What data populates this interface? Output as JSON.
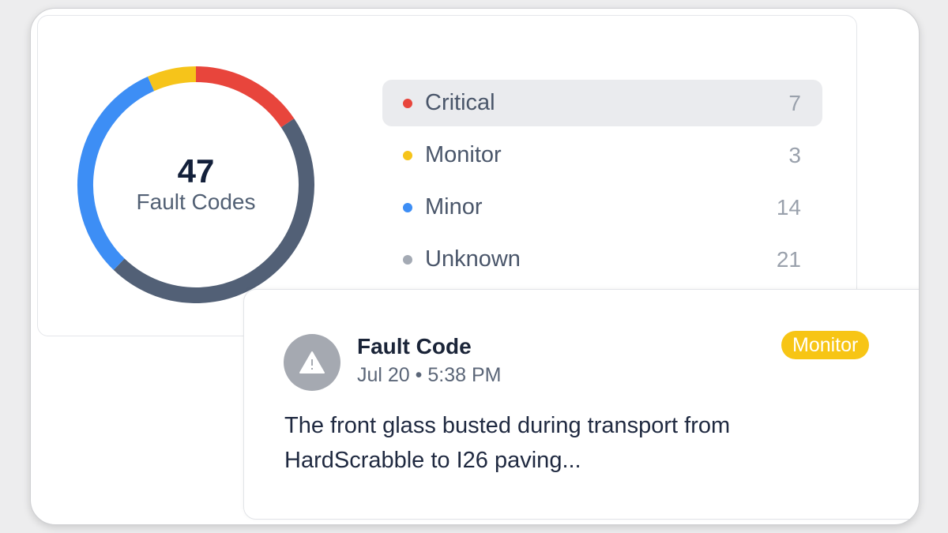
{
  "summary": {
    "total": "47",
    "total_label": "Fault Codes",
    "segments": [
      {
        "name": "Critical",
        "count": "7",
        "value": 7,
        "color": "#e8453c"
      },
      {
        "name": "Monitor",
        "count": "3",
        "value": 3,
        "color": "#f6c41a"
      },
      {
        "name": "Minor",
        "count": "14",
        "value": 14,
        "color": "#3d8ef5"
      },
      {
        "name": "Unknown",
        "count": "21",
        "value": 21,
        "color": "#a4aab4"
      }
    ],
    "ring_unknown_color": "#526076",
    "active_segment": "Critical"
  },
  "detail": {
    "icon": "warning-triangle-icon",
    "title": "Fault Code",
    "timestamp": "Jul 20 • 5:38 PM",
    "badge": "Monitor",
    "badge_color": "#f7c515",
    "body": "The front glass busted during transport from HardScrabble to I26 paving..."
  }
}
